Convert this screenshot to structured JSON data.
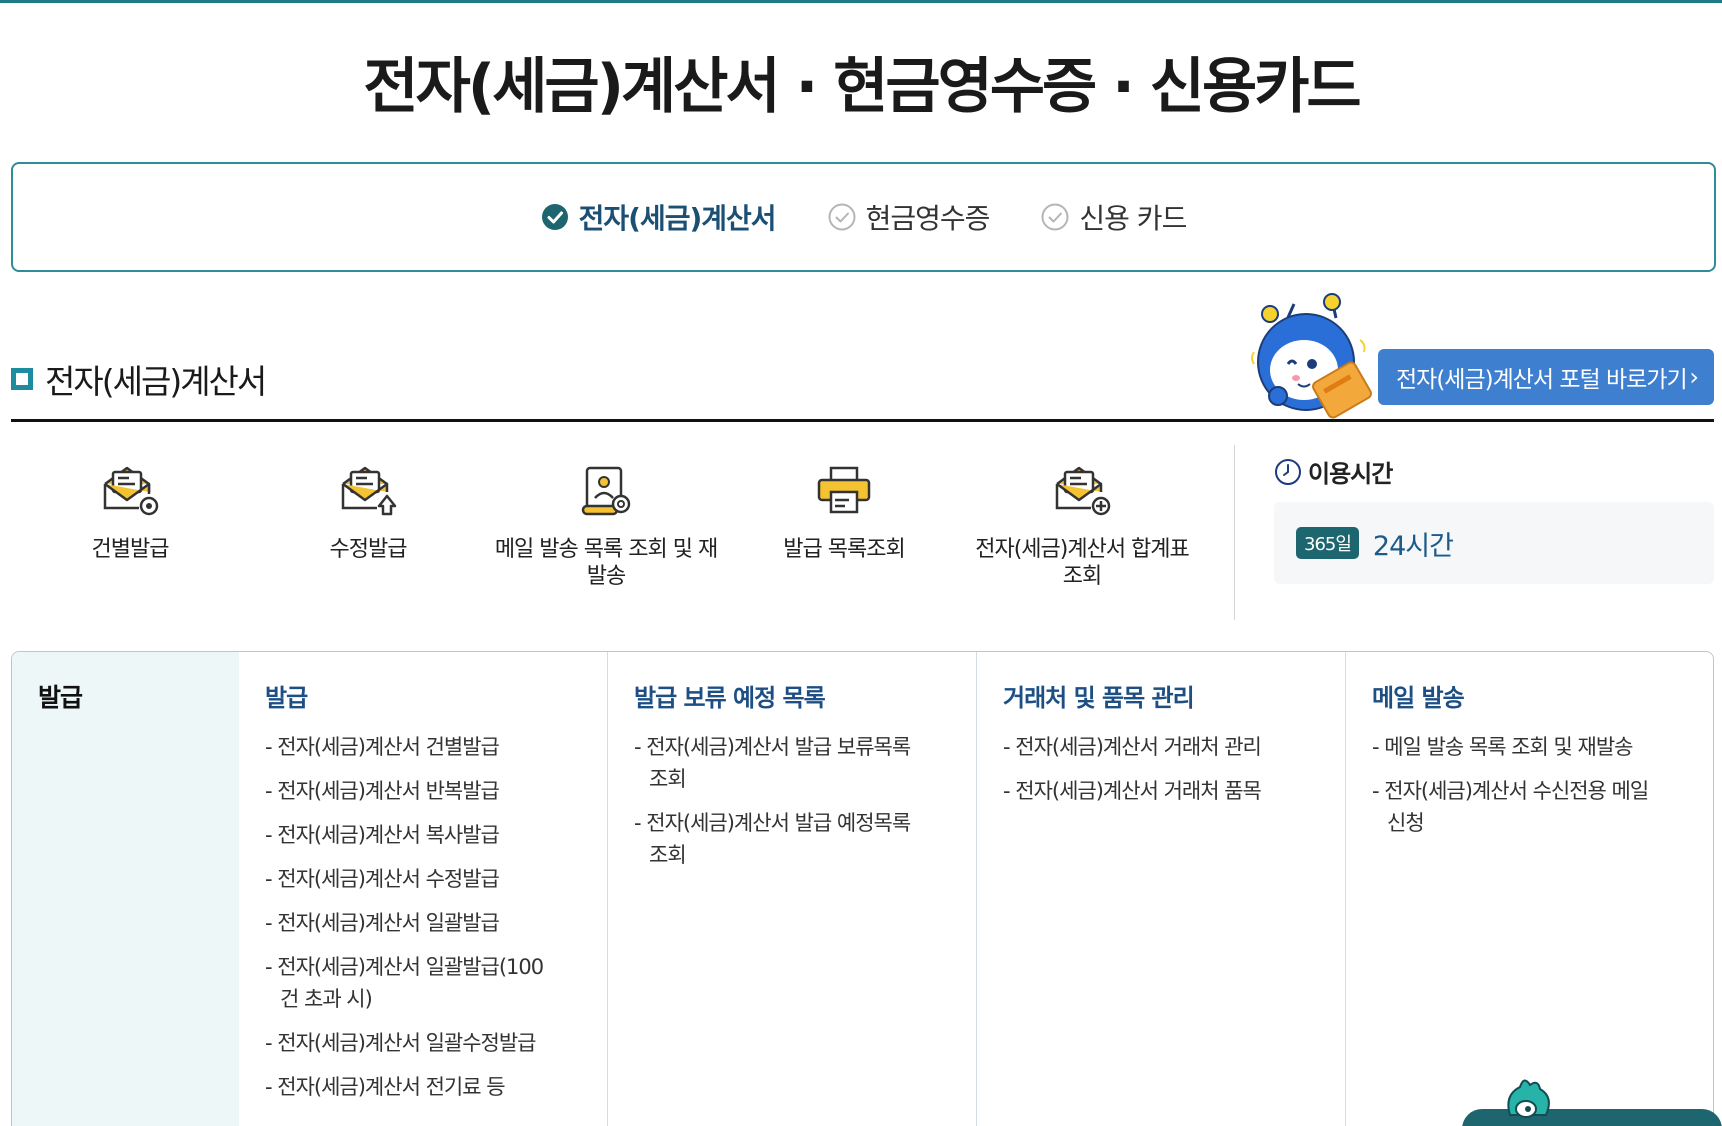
{
  "page": {
    "title": "전자(세금)계산서 · 현금영수증 · 신용카드"
  },
  "tabs": [
    {
      "label": "전자(세금)계산서",
      "active": true
    },
    {
      "label": "현금영수증",
      "active": false
    },
    {
      "label": "신용 카드",
      "active": false
    }
  ],
  "section": {
    "title": "전자(세금)계산서",
    "portal_button": "전자(세금)계산서 포털 바로가기"
  },
  "quick_links": [
    {
      "label": "건별발급",
      "icon": "envelope-gear-icon"
    },
    {
      "label": "수정발급",
      "icon": "envelope-arrow-icon"
    },
    {
      "label": "메일 발송 목록 조회 및 재발송",
      "icon": "scroll-search-icon"
    },
    {
      "label": "발급 목록조회",
      "icon": "printer-icon"
    },
    {
      "label": "전자(세금)계산서 합계표 조회",
      "icon": "envelope-plus-icon"
    }
  ],
  "hours": {
    "title": "이용시간",
    "badge": "365일",
    "value": "24시간"
  },
  "menu": {
    "category": "발급",
    "columns": [
      {
        "title": "발급",
        "items": [
          "전자(세금)계산서 건별발급",
          "전자(세금)계산서 반복발급",
          "전자(세금)계산서 복사발급",
          "전자(세금)계산서 수정발급",
          "전자(세금)계산서 일괄발급",
          "전자(세금)계산서 일괄발급(100건 초과 시)",
          "전자(세금)계산서 일괄수정발급",
          "전자(세금)계산서 전기료 등"
        ]
      },
      {
        "title": "발급 보류 예정 목록",
        "items": [
          "전자(세금)계산서 발급 보류목록 조회",
          "전자(세금)계산서 발급 예정목록 조회"
        ]
      },
      {
        "title": "거래처 및 품목 관리",
        "items": [
          "전자(세금)계산서 거래처 관리",
          "전자(세금)계산서 거래처 품목"
        ]
      },
      {
        "title": "메일 발송",
        "items": [
          "메일 발송 목록 조회 및 재발송",
          "전자(세금)계산서 수신전용 메일 신청"
        ]
      }
    ]
  },
  "colors": {
    "accent_teal": "#1d7a86",
    "button_blue": "#3f7fd0",
    "title_navy": "#1d4f85",
    "category_bg": "#eef7f8"
  }
}
